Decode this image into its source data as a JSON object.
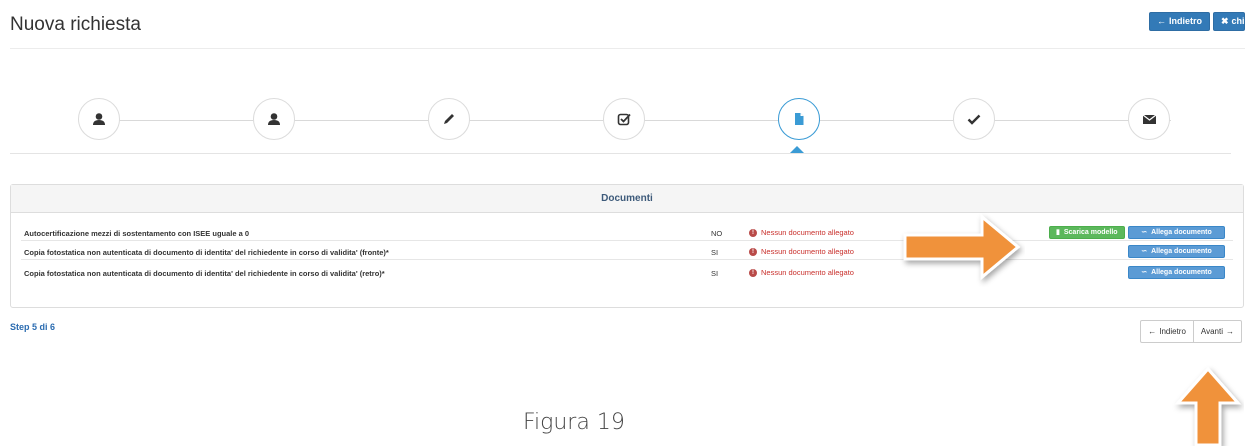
{
  "header": {
    "title": "Nuova richiesta",
    "back_label": "Indietro",
    "close_label": "chiudi"
  },
  "stepper": {
    "steps": [
      {
        "icon": "user-icon",
        "active": false
      },
      {
        "icon": "user-icon",
        "active": false
      },
      {
        "icon": "pencil-icon",
        "active": false
      },
      {
        "icon": "checkbox-icon",
        "active": false
      },
      {
        "icon": "file-icon",
        "active": true
      },
      {
        "icon": "check-icon",
        "active": false
      },
      {
        "icon": "envelope-icon",
        "active": false
      }
    ]
  },
  "documents": {
    "title": "Documenti",
    "rows": [
      {
        "name": "Autocertificazione mezzi di sostentamento con ISEE uguale a 0",
        "required": "NO",
        "status": "Nessun documento allegato",
        "has_template": true
      },
      {
        "name": "Copia fotostatica non autenticata di documento di identita' del richiedente in corso di validita' (fronte)*",
        "required": "SI",
        "status": "Nessun documento allegato",
        "has_template": false
      },
      {
        "name": "Copia fotostatica non autenticata di documento di identita' del richiedente in corso di validita' (retro)*",
        "required": "SI",
        "status": "Nessun documento allegato",
        "has_template": false
      }
    ],
    "template_button_label": "Scarica modello",
    "attach_button_label": "Allega documento"
  },
  "footer": {
    "step_text": "Step 5 di 6",
    "prev_label": "Indietro",
    "next_label": "Avanti"
  },
  "caption": "Figura 19",
  "colors": {
    "primary": "#337ab7",
    "active_step": "#3a9bd5",
    "success": "#5cb85c",
    "danger": "#c9302c",
    "annotation_arrow": "#f0923a"
  }
}
